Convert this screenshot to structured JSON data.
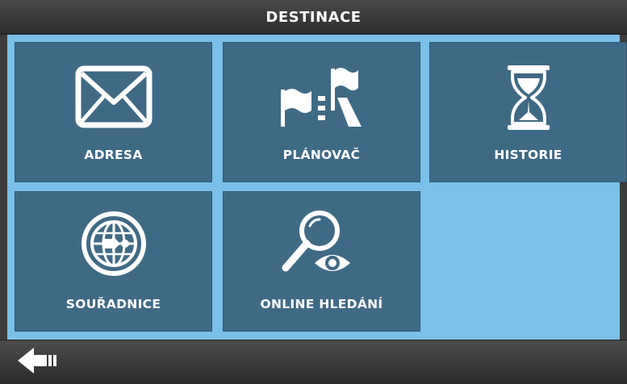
{
  "header": {
    "title": "DESTINACE"
  },
  "tiles": [
    {
      "label": "ADRESA",
      "icon": "envelope-icon"
    },
    {
      "label": "PLÁNOVAČ",
      "icon": "route-flags-icon"
    },
    {
      "label": "HISTORIE",
      "icon": "hourglass-icon"
    },
    {
      "label": "SOUŘADNICE",
      "icon": "globe-crosshair-icon"
    },
    {
      "label": "ONLINE HLEDÁNÍ",
      "icon": "magnifier-eye-icon"
    }
  ],
  "footer": {
    "back_icon": "back-arrow-icon"
  },
  "colors": {
    "background": "#7ac0e8",
    "tile": "#3f6a85",
    "bar": "#3a3a3a",
    "text": "#ffffff"
  }
}
